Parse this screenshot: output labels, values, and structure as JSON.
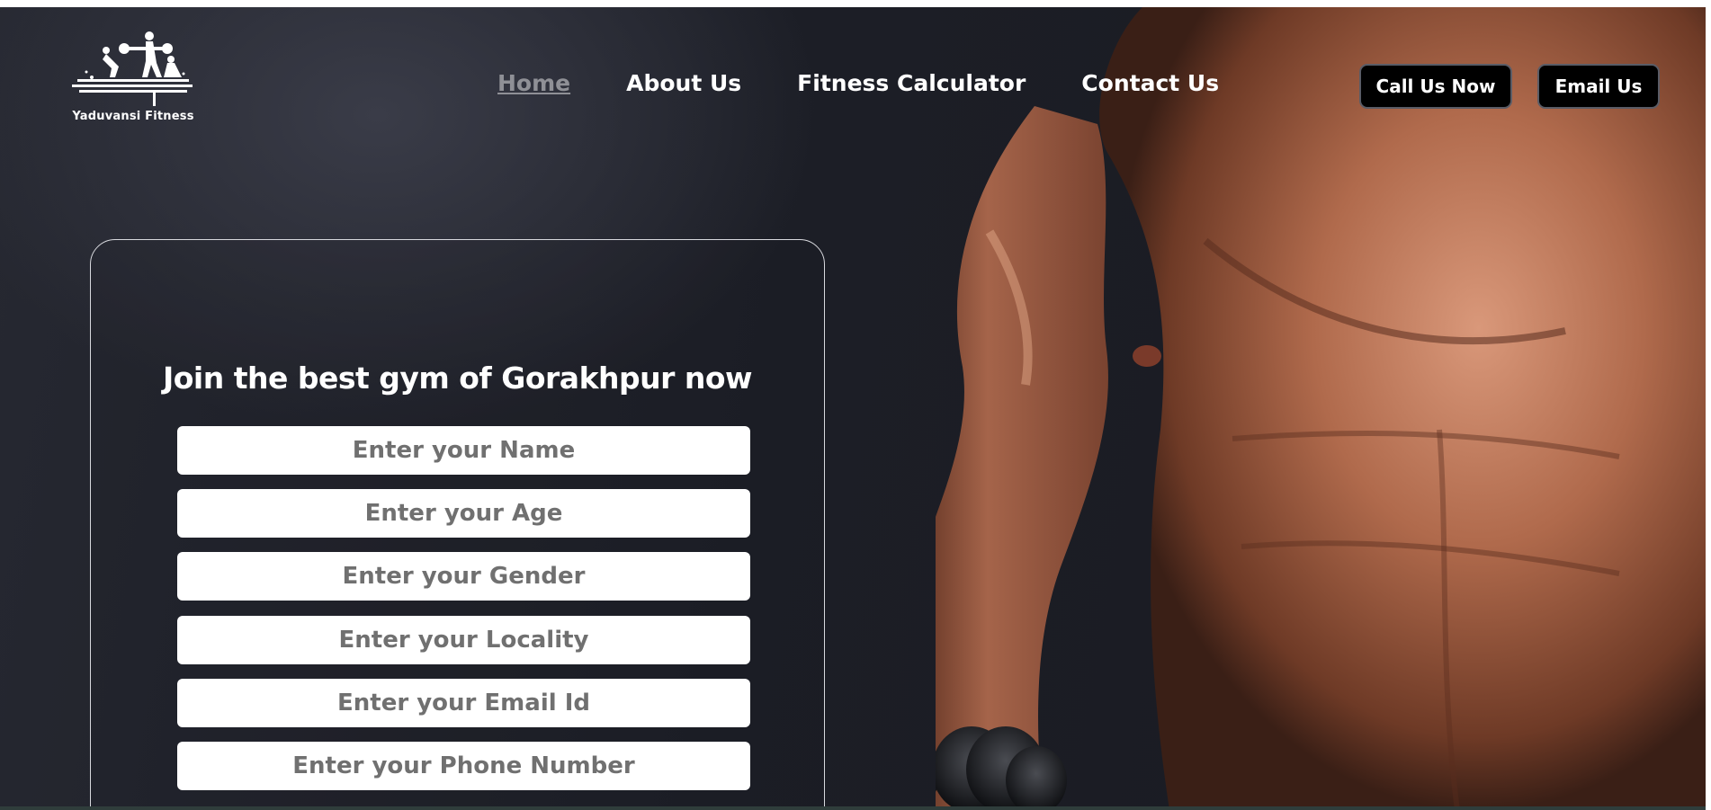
{
  "brand": {
    "name": "Yaduvansi Fitness",
    "logo_icon": "gym-athletes-logo-icon"
  },
  "nav": {
    "items": [
      {
        "label": "Home",
        "active": true
      },
      {
        "label": "About Us",
        "active": false
      },
      {
        "label": "Fitness Calculator",
        "active": false
      },
      {
        "label": "Contact Us",
        "active": false
      }
    ]
  },
  "actions": {
    "call_label": "Call Us Now",
    "email_label": "Email Us"
  },
  "form": {
    "title": "Join the best gym of Gorakhpur now",
    "fields": [
      {
        "placeholder": "Enter your Name"
      },
      {
        "placeholder": "Enter your Age"
      },
      {
        "placeholder": "Enter your Gender"
      },
      {
        "placeholder": "Enter your Locality"
      },
      {
        "placeholder": "Enter your Email Id"
      },
      {
        "placeholder": "Enter your Phone Number"
      }
    ]
  },
  "hero": {
    "image_subject": "muscular-man-with-dumbbell-image"
  },
  "colors": {
    "background": "#1f2129",
    "nav_active": "#8f9096",
    "button_bg": "#000000",
    "text": "#ffffff"
  }
}
